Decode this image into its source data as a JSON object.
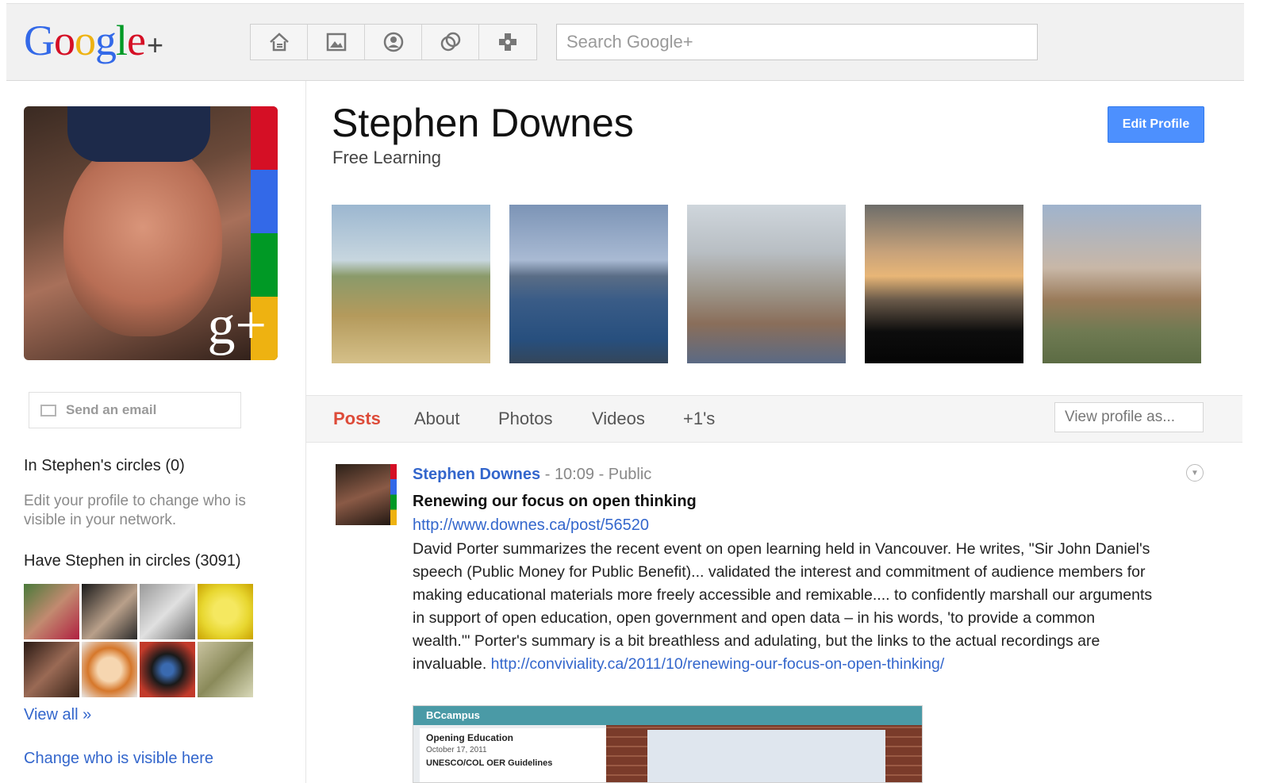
{
  "header": {
    "logo_text": "Google",
    "logo_plus": "+",
    "nav_icons": [
      "home-icon",
      "photos-icon",
      "profile-icon",
      "circles-icon",
      "games-icon"
    ],
    "search_placeholder": "Search Google+"
  },
  "sidebar": {
    "send_email_label": "Send an email",
    "in_circles_title": "In Stephen's circles (0)",
    "in_circles_note": "Edit your profile to change who is visible in your network.",
    "have_circles_title": "Have Stephen in circles (3091)",
    "view_all_label": "View all »",
    "change_visible_label": "Change who is visible here",
    "avatar_badge": "g+"
  },
  "profile": {
    "name": "Stephen Downes",
    "tagline": "Free Learning",
    "edit_button_label": "Edit Profile"
  },
  "tabs": {
    "items": [
      {
        "label": "Posts",
        "active": true
      },
      {
        "label": "About",
        "active": false
      },
      {
        "label": "Photos",
        "active": false
      },
      {
        "label": "Videos",
        "active": false
      },
      {
        "label": "+1's",
        "active": false
      }
    ],
    "view_profile_as": "View profile as..."
  },
  "post": {
    "author": "Stephen Downes",
    "separator": "-",
    "time": "10:09",
    "visibility": "Public",
    "title": "Renewing our focus on open thinking",
    "url": "http://www.downes.ca/post/56520",
    "body": "David Porter summarizes the recent event on open learning held in Vancouver. He writes, \"Sir John Daniel's speech (Public Money for Public Benefit)... validated the interest and commitment of audience members for making educational materials more freely accessible and remixable.... to confidently marshall our arguments in support of open education, open government and open data – in his words, 'to provide a common wealth.'\" Porter's summary is a bit breathless and adulating, but the links to the actual recordings are invaluable. ",
    "body_link": "http://conviviality.ca/2011/10/renewing-our-focus-on-open-thinking/",
    "attachment": {
      "brand": "BCcampus",
      "card_title": "Opening Education",
      "card_date": "October 17, 2011",
      "card_sub": "UNESCO/COL OER Guidelines"
    }
  },
  "colors": {
    "accent_blue": "#4d90fe",
    "link_blue": "#3366cc",
    "active_tab_red": "#dd4b39",
    "google_red": "#d50f25",
    "google_blue": "#3369e8",
    "google_green": "#009925",
    "google_yellow": "#eeb211"
  }
}
